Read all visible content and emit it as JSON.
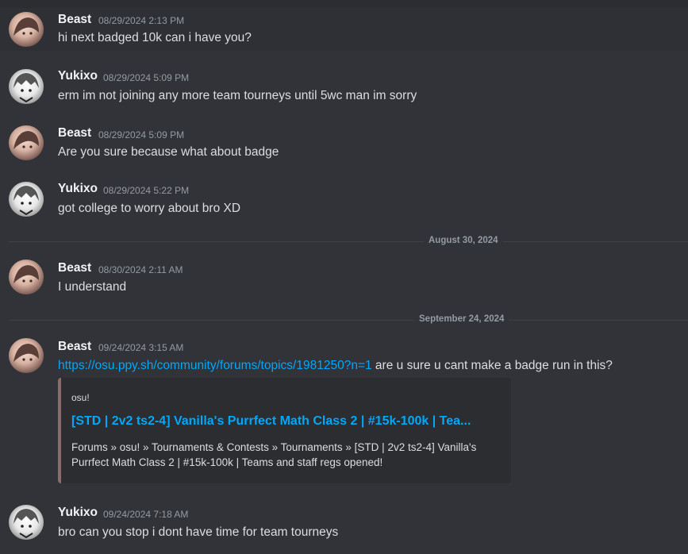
{
  "messages": [
    {
      "author": "Beast",
      "timestamp": "08/29/2024 2:13 PM",
      "text": "hi next badged 10k can i have you?"
    },
    {
      "author": "Yukixo",
      "timestamp": "08/29/2024 5:09 PM",
      "text": "erm im not joining any more team tourneys until 5wc man im sorry"
    },
    {
      "author": "Beast",
      "timestamp": "08/29/2024 5:09 PM",
      "text": "Are you sure because what about badge"
    },
    {
      "author": "Yukixo",
      "timestamp": "08/29/2024 5:22 PM",
      "text": "got college to worry about bro XD"
    },
    {
      "author": "Beast",
      "timestamp": "08/30/2024 2:11 AM",
      "text": "I understand"
    },
    {
      "author": "Beast",
      "timestamp": "09/24/2024 3:15 AM",
      "link": "https://osu.ppy.sh/community/forums/topics/1981250?n=1",
      "text": " are u sure u cant make a badge run in this?"
    },
    {
      "author": "Yukixo",
      "timestamp": "09/24/2024 7:18 AM",
      "text": "bro can you stop i dont have time for team tourneys"
    }
  ],
  "dividers": [
    "August 30, 2024",
    "September 24, 2024"
  ],
  "embed": {
    "provider": "osu!",
    "title": "[STD | 2v2 ts2-4] Vanilla's Purrfect Math Class 2 | #15k-100k | Tea...",
    "description": "Forums » osu! » Tournaments & Contests » Tournaments » [STD | 2v2 ts2-4] Vanilla's Purrfect Math Class 2 | #15k-100k | Teams and staff regs opened!",
    "accent_color": "#8a6d6b"
  },
  "colors": {
    "background": "#313338",
    "link": "#00a8fc",
    "muted": "#949ba4"
  }
}
